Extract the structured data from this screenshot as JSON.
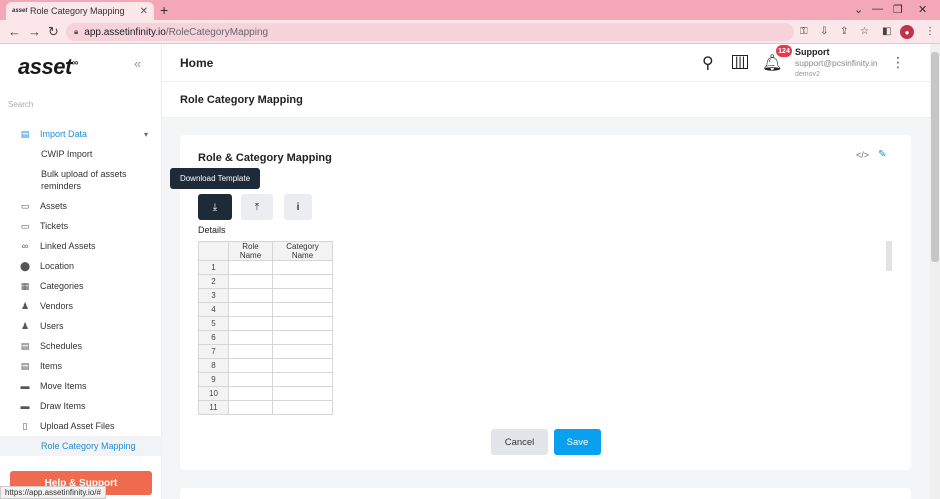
{
  "browser": {
    "tab_title": "Role Category Mapping",
    "favicon_text": "asset",
    "new_tab": "+",
    "url_host": "app.assetinfinity.io",
    "url_path": "/RoleCategoryMapping",
    "status_url": "https://app.assetinfinity.io/#"
  },
  "sidebar": {
    "logo": "asset",
    "logo_mark": "∞",
    "search_placeholder": "Search",
    "import_data": "Import Data",
    "sub_items": [
      "CWIP Import",
      "Bulk upload of assets reminders"
    ],
    "items": [
      {
        "label": "Assets",
        "icon": "monitor-icon",
        "glyph": "▭"
      },
      {
        "label": "Tickets",
        "icon": "ticket-icon",
        "glyph": "▭"
      },
      {
        "label": "Linked Assets",
        "icon": "link-icon",
        "glyph": "∞"
      },
      {
        "label": "Location",
        "icon": "location-pin-icon",
        "glyph": "⬤"
      },
      {
        "label": "Categories",
        "icon": "grid-icon",
        "glyph": "▦"
      },
      {
        "label": "Vendors",
        "icon": "vendor-icon",
        "glyph": "♟"
      },
      {
        "label": "Users",
        "icon": "user-icon",
        "glyph": "♟"
      },
      {
        "label": "Schedules",
        "icon": "schedule-icon",
        "glyph": "▤"
      },
      {
        "label": "Items",
        "icon": "items-icon",
        "glyph": "▤"
      },
      {
        "label": "Move Items",
        "icon": "truck-icon",
        "glyph": "▬"
      },
      {
        "label": "Draw Items",
        "icon": "draw-icon",
        "glyph": "▬"
      },
      {
        "label": "Upload Asset Files",
        "icon": "file-upload-icon",
        "glyph": "▯"
      }
    ],
    "selected_item": "Role Category Mapping",
    "help_button": "Help & Support"
  },
  "header": {
    "title": "Home",
    "notification_count": "124",
    "user_name": "Support",
    "user_email": "support@pcsinfinity.in",
    "user_org": "demov2"
  },
  "page_title": "Role Category Mapping",
  "card": {
    "title": "Role & Category Mapping",
    "tooltip": "Download Template",
    "details_label": "Details",
    "columns": [
      "Role Name",
      "Category Name"
    ],
    "row_numbers": [
      "1",
      "2",
      "3",
      "4",
      "5",
      "6",
      "7",
      "8",
      "9",
      "10",
      "11"
    ],
    "cancel_label": "Cancel",
    "save_label": "Save"
  },
  "colors": {
    "accent": "#0aa0f0",
    "dark_button": "#1e2a38",
    "help_button": "#ef6a4e",
    "browser_frame": "#f3a7b7"
  }
}
